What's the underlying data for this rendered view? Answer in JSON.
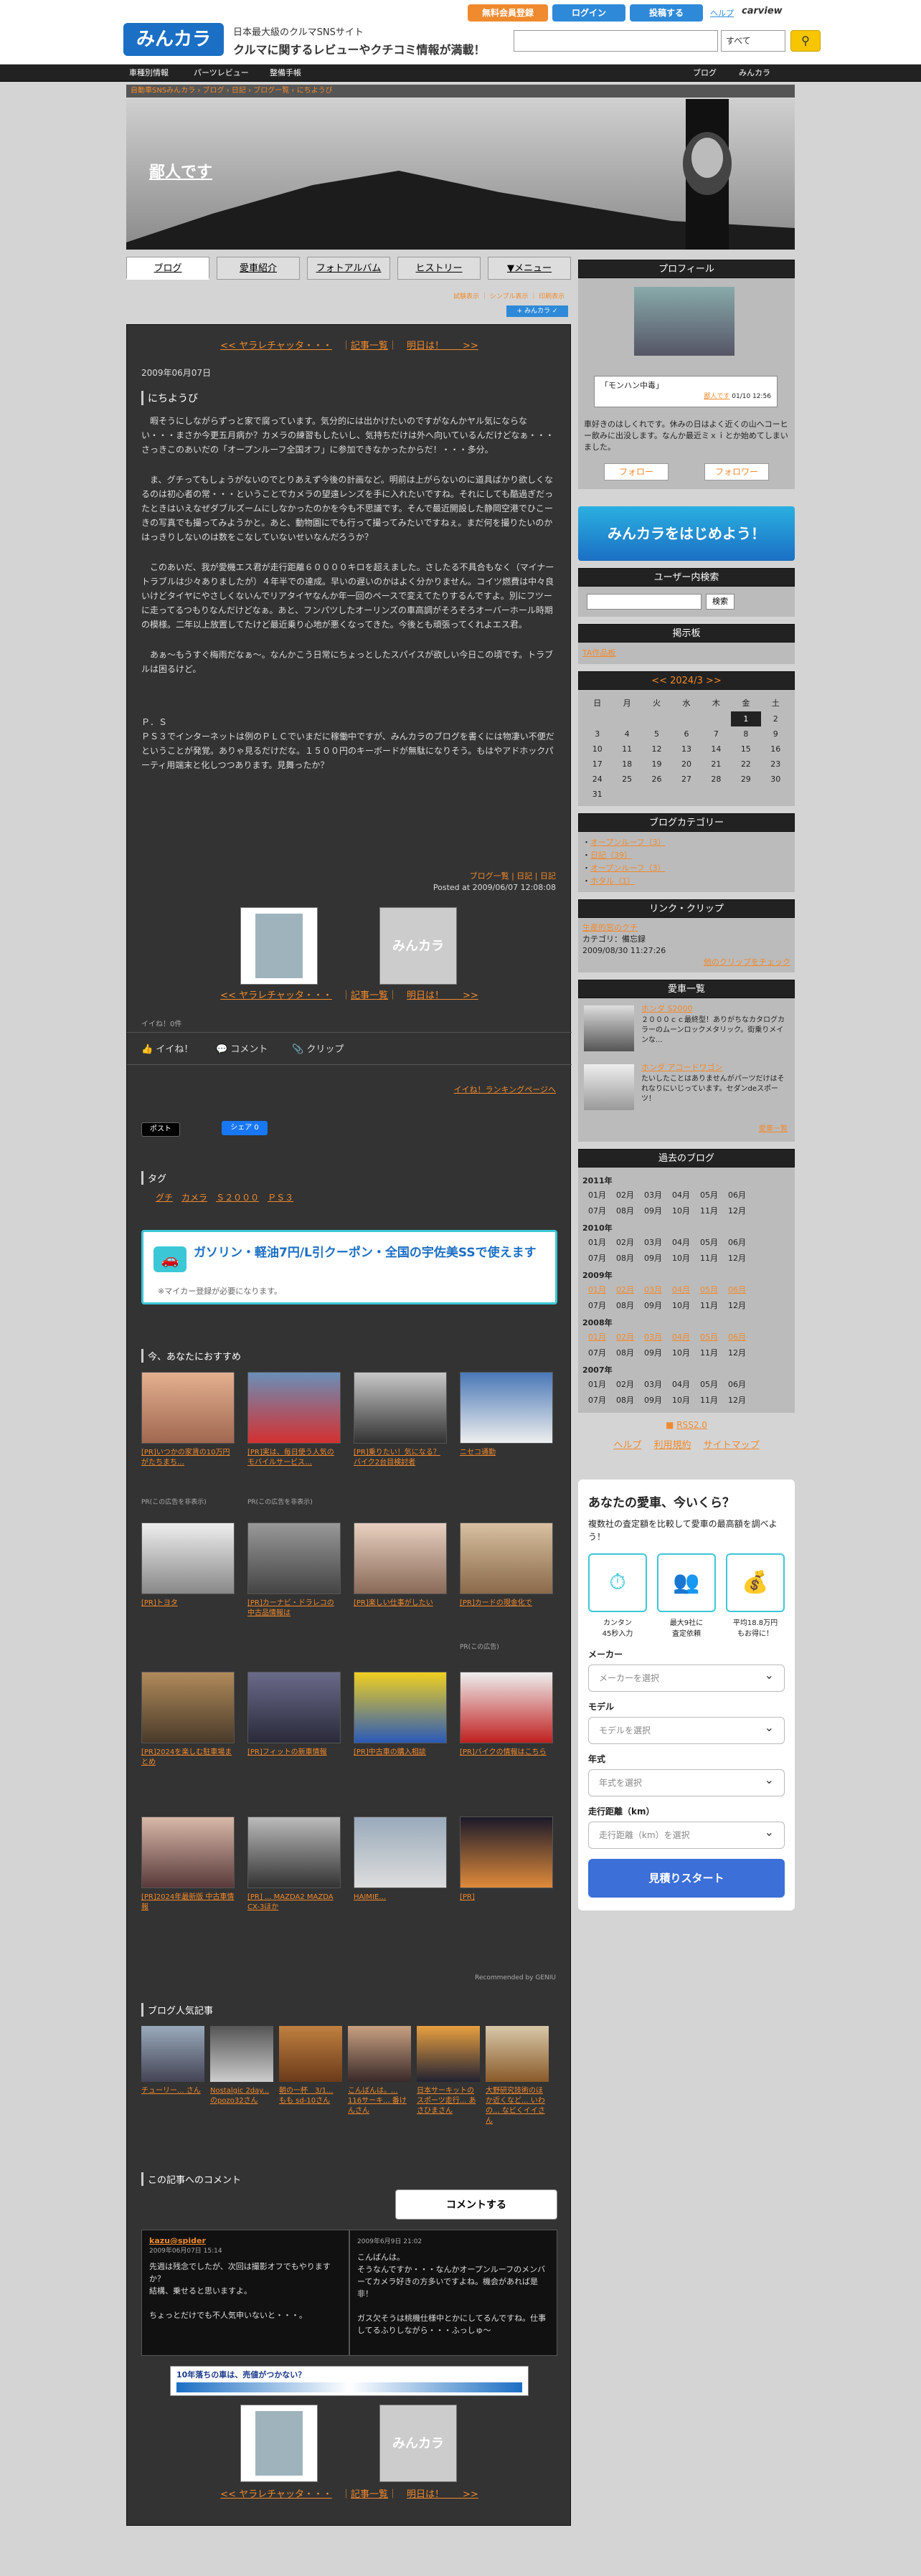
{
  "topbar": {
    "join": "無料会員登録",
    "login": "ログイン",
    "post": "投稿する",
    "help": "ヘルプ",
    "carview": "carview",
    "logo": "みんカラ",
    "tagline1": "日本最大級のクルマSNSサイト",
    "tagline2": "クルマに関するレビューやクチコミ情報が満載！",
    "search_select": "すべて",
    "search_icon": "search-icon"
  },
  "gnav": {
    "left": [
      "車種別情報",
      "パーツレビュー",
      "整備手帳"
    ],
    "right": [
      "ブログ",
      "みんカラ"
    ]
  },
  "breadcrumb": "自動車SNSみんカラ › ブログ › 日記 › ブログ一覧 › にちようび",
  "header": {
    "title": "鄙人です"
  },
  "tabs": [
    "ブログ",
    "愛車紹介",
    "フォトアルバム",
    "ヒストリー",
    "▼メニュー"
  ],
  "toolinks": "試験表示 ｜ シンプル表示 ｜ 印刷表示",
  "post": {
    "nav": {
      "prev": "<< ヤラレチャッタ・・・",
      "list": "記事一覧",
      "next": "明日は！　　>>"
    },
    "date": "2009年06月07日",
    "title": "にちようび",
    "paragraphs": [
      "　暇そうにしながらずっと家で腐っています。気分的には出かけたいのですがなんかヤル気にならない・・・まさか今更五月病か？カメラの練習もしたいし、気持ちだけは外へ向いているんだけどなぁ・・・さっきこのあいだの「オープンルーフ全国オフ」に参加できなかったからだ！・・・多分。",
      "　ま、グチってもしょうがないのでとりあえず今後の計画など。明前は上がらないのに道具ばかり欲しくなるのは初心者の常・・・ということでカメラの望遠レンズを手に入れたいですね。それにしても酷過ぎだったときはいえなぜダブルズームにしなかったのかを今も不思議です。そんで最近開設した静岡空港でひこーきの写真でも撮ってみようかと。あと、動物園にでも行って撮ってみたいですねぇ。まだ何を撮りたいのかはっきりしないのは数をこなしていないせいなんだろうか？",
      "　このあいだ、我が愛機エス君が走行距離６００００キロを超えました。さしたる不具合もなく（マイナートラブルは少々ありましたが）４年半での達成。早いの遅いのかはよく分かりません。コイツ燃費は中々良いけどタイヤにやさしくないんでリアタイヤなんか年一回のペースで変えてたりするんですよ。別にフツーに走ってるつもりなんだけどなぁ。あと、フンパツしたオーリンズの車高調がそろそろオーバーホール時期の模様。二年以上放置してたけど最近乗り心地が悪くなってきた。今後とも頑張ってくれよエス君。",
      "　あぁ〜もうすぐ梅雨だなぁ〜。なんかこう日常にちょっとしたスパイスが欲しい今日この頃です。トラブルは困るけど。",
      "Ｐ．Ｓ\nＰＳ３でインターネットは例のＰＬＣでいまだに稼働中ですが、みんカラのブログを書くには物凄い不便だということが発覚。ありゃ見るだけだな。１５００円のキーボードが無駄になりそう。もはやアドホックパーティ用端末と化しつつあります。見舞ったか？"
    ],
    "meta1": "ブログ一覧 | 日記 | 日記",
    "meta2": "Posted at 2009/06/07 12:08:08",
    "like_count": "イイね！0件",
    "actions": [
      "イイね！",
      "コメント",
      "クリップ"
    ],
    "ranking": "イイね！ランキングページへ",
    "tweet": "ポスト",
    "fb": "シェア 0",
    "tags_h": "タグ",
    "tags": [
      "グチ",
      "カメラ",
      "Ｓ２０００",
      "ＰＳ３"
    ],
    "ad_title": "ガソリン・軽油7円/L引クーポン・全国の宇佐美SSで使えます",
    "ad_sub": "※マイカー登録が必要になります。",
    "rec_h": "今、あなたにおすすめ",
    "rec": [
      "[PR]いつかの家賃の10万円がたちまち…",
      "[PR]実は、毎日使う人気のモバイルサービス…",
      "[PR]乗りたい！気になる？バイク2台目検討者",
      "ニセコ通勤",
      "[PR]トヨタ",
      "[PR]カーナビ・ドラレコの中古品情報は",
      "[PR]楽しい仕事がしたい",
      "[PR]カードの現金化で",
      "[PR]2024を楽しむ駐車場まとめ",
      "[PR]フィットの新車情報",
      "[PR]中古車の購入相談",
      "[PR]バイクの情報はこちら",
      "[PR]2024年最新版 中古車情報",
      "[PR] ... MAZDA2 MAZDA CX-3ほか",
      "HAIMIE…",
      "[PR]"
    ],
    "pr": [
      "PR(この広告を非表示)",
      "PR(この広告を非表示)",
      "PR(この広告)"
    ],
    "recommended": "Recommended by GENIU",
    "pop_h": "ブログ人気記事",
    "pop": [
      "チューリー... さん",
      "Nostalgic 2day... のpozo32さん",
      "朝の一杯　3/1... もも sd-10さん",
      "こんばんは。... 116サーキ... 番けんさん",
      "日本サーキットのスポーツ走行... あさひまさん",
      "大野研究技術のほか近くなど... いわの... なビくイイさん"
    ],
    "cmt_h": "この記事へのコメント",
    "cmt_btn": "コメントする",
    "comments": [
      {
        "name": "kazu@spider",
        "date": "2009年06月07日 15:14",
        "text": "先週は残念でしたが、次回は撮影オフでもやりますか？\n結構、乗せると思いますよ。\n\nちょっとだけでも不人気申いないと・・・。"
      },
      {
        "name": "",
        "date": "2009年6月9日 21:02",
        "text": "こんばんは。\nそうなんですか・・・なんかオープンルーフのメンバーてカメラ好きの方多いですよね。機会があれば是非！\n\nガス欠そうは桃機仕様中とかにしてるんですね。仕事してるふりしながら・・・ふっしゅ〜"
      }
    ],
    "banner": "10年落ちの車は、売値がつかない？",
    "nav2": {
      "prev": "<< ヤラレチャッタ・・・",
      "list": "記事一覧",
      "next": "明日は！　　>>"
    }
  },
  "side": {
    "profile_h": "プロフィール",
    "profile_caption": "「モンハン中毒」",
    "profile_user": "鄙人です",
    "profile_date": "01/10 12:56",
    "profile_text": "車好きのはしくれです。休みの日はよく近くの山へコーヒー飲みに出没します。なんか最近ミｘｉとか始めてしまいました。",
    "follow": "フォロー",
    "follower": "フォロワー",
    "banner": "みんカラをはじめよう！",
    "search_h": "ユーザー内検索",
    "search_btn": "検索",
    "board_h": "掲示板",
    "board_link": "TA作品板",
    "cal_h": "<< 2024/3 >>",
    "cal_days": [
      "日",
      "月",
      "火",
      "水",
      "木",
      "金",
      "土"
    ],
    "cal_rows": [
      [
        "",
        "",
        "",
        "",
        "",
        "1",
        "2"
      ],
      [
        "3",
        "4",
        "5",
        "6",
        "7",
        "8",
        "9"
      ],
      [
        "10",
        "11",
        "12",
        "13",
        "14",
        "15",
        "16"
      ],
      [
        "17",
        "18",
        "19",
        "20",
        "21",
        "22",
        "23"
      ],
      [
        "24",
        "25",
        "26",
        "27",
        "28",
        "29",
        "30"
      ],
      [
        "31",
        "",
        "",
        "",
        "",
        "",
        ""
      ]
    ],
    "cat_h": "ブログカテゴリー",
    "cats": [
      "オープンルーフ（3）",
      "日記（39）",
      "オープンルーフ（3）",
      "ホタル（1）"
    ],
    "clip_h": "リンク・クリップ",
    "clip_title": "生産的窓のクチ",
    "clip_cat": "カテゴリ：備忘録",
    "clip_date": "2009/08/30 11:27:26",
    "clip_more": "他のクリップをチェック",
    "car_h": "愛車一覧",
    "cars": [
      {
        "name": "ホンダ S2000",
        "desc": "２０００ｃｃ最終型！ありがちなカタログカラーのムーンロックメタリック。街乗りメインな..."
      },
      {
        "name": "ホンダ アコードワゴン",
        "desc": "たいしたことはありませんがパーツだけはそれなりにいじっています。セダンdeスポーツ！"
      }
    ],
    "car_more": "愛車一覧",
    "arch_h": "過去のブログ",
    "arch": [
      {
        "y": "2011年",
        "m": [
          "01月",
          "02月",
          "03月",
          "04月",
          "05月",
          "06月",
          "07月",
          "08月",
          "09月",
          "10月",
          "11月",
          "12月"
        ]
      },
      {
        "y": "2010年",
        "m": [
          "01月",
          "02月",
          "03月",
          "04月",
          "05月",
          "06月",
          "07月",
          "08月",
          "09月",
          "10月",
          "11月",
          "12月"
        ]
      },
      {
        "y": "2009年",
        "m": [
          "01月",
          "02月",
          "03月",
          "04月",
          "05月",
          "06月",
          "07月",
          "08月",
          "09月",
          "10月",
          "11月",
          "12月"
        ]
      },
      {
        "y": "2008年",
        "m": [
          "01月",
          "02月",
          "03月",
          "04月",
          "05月",
          "06月",
          "07月",
          "08月",
          "09月",
          "10月",
          "11月",
          "12月"
        ]
      },
      {
        "y": "2007年",
        "m": [
          "01月",
          "02月",
          "03月",
          "04月",
          "05月",
          "06月",
          "07月",
          "08月",
          "09月",
          "10月",
          "11月",
          "12月"
        ]
      }
    ],
    "rss": "RSS2.0",
    "footer_links": [
      "ヘルプ",
      "利用規約",
      "サイトマップ"
    ],
    "sat_h": "あなたの愛車、今いくら？",
    "sat_sub": "複数社の査定額を比較して愛車の最高額を調べよう！",
    "sat_icons": [
      {
        "t": "カンタン\n45秒入力"
      },
      {
        "t": "最大9社に\n査定依頼"
      },
      {
        "t": "平均18.8万円\nもお得に！"
      }
    ],
    "sat_fields": [
      {
        "label": "メーカー",
        "ph": "メーカーを選択"
      },
      {
        "label": "モデル",
        "ph": "モデルを選択"
      },
      {
        "label": "年式",
        "ph": "年式を選択"
      },
      {
        "label": "走行距離（km）",
        "ph": "走行距離（km）を選択"
      }
    ],
    "sat_btn": "見積りスタート"
  }
}
